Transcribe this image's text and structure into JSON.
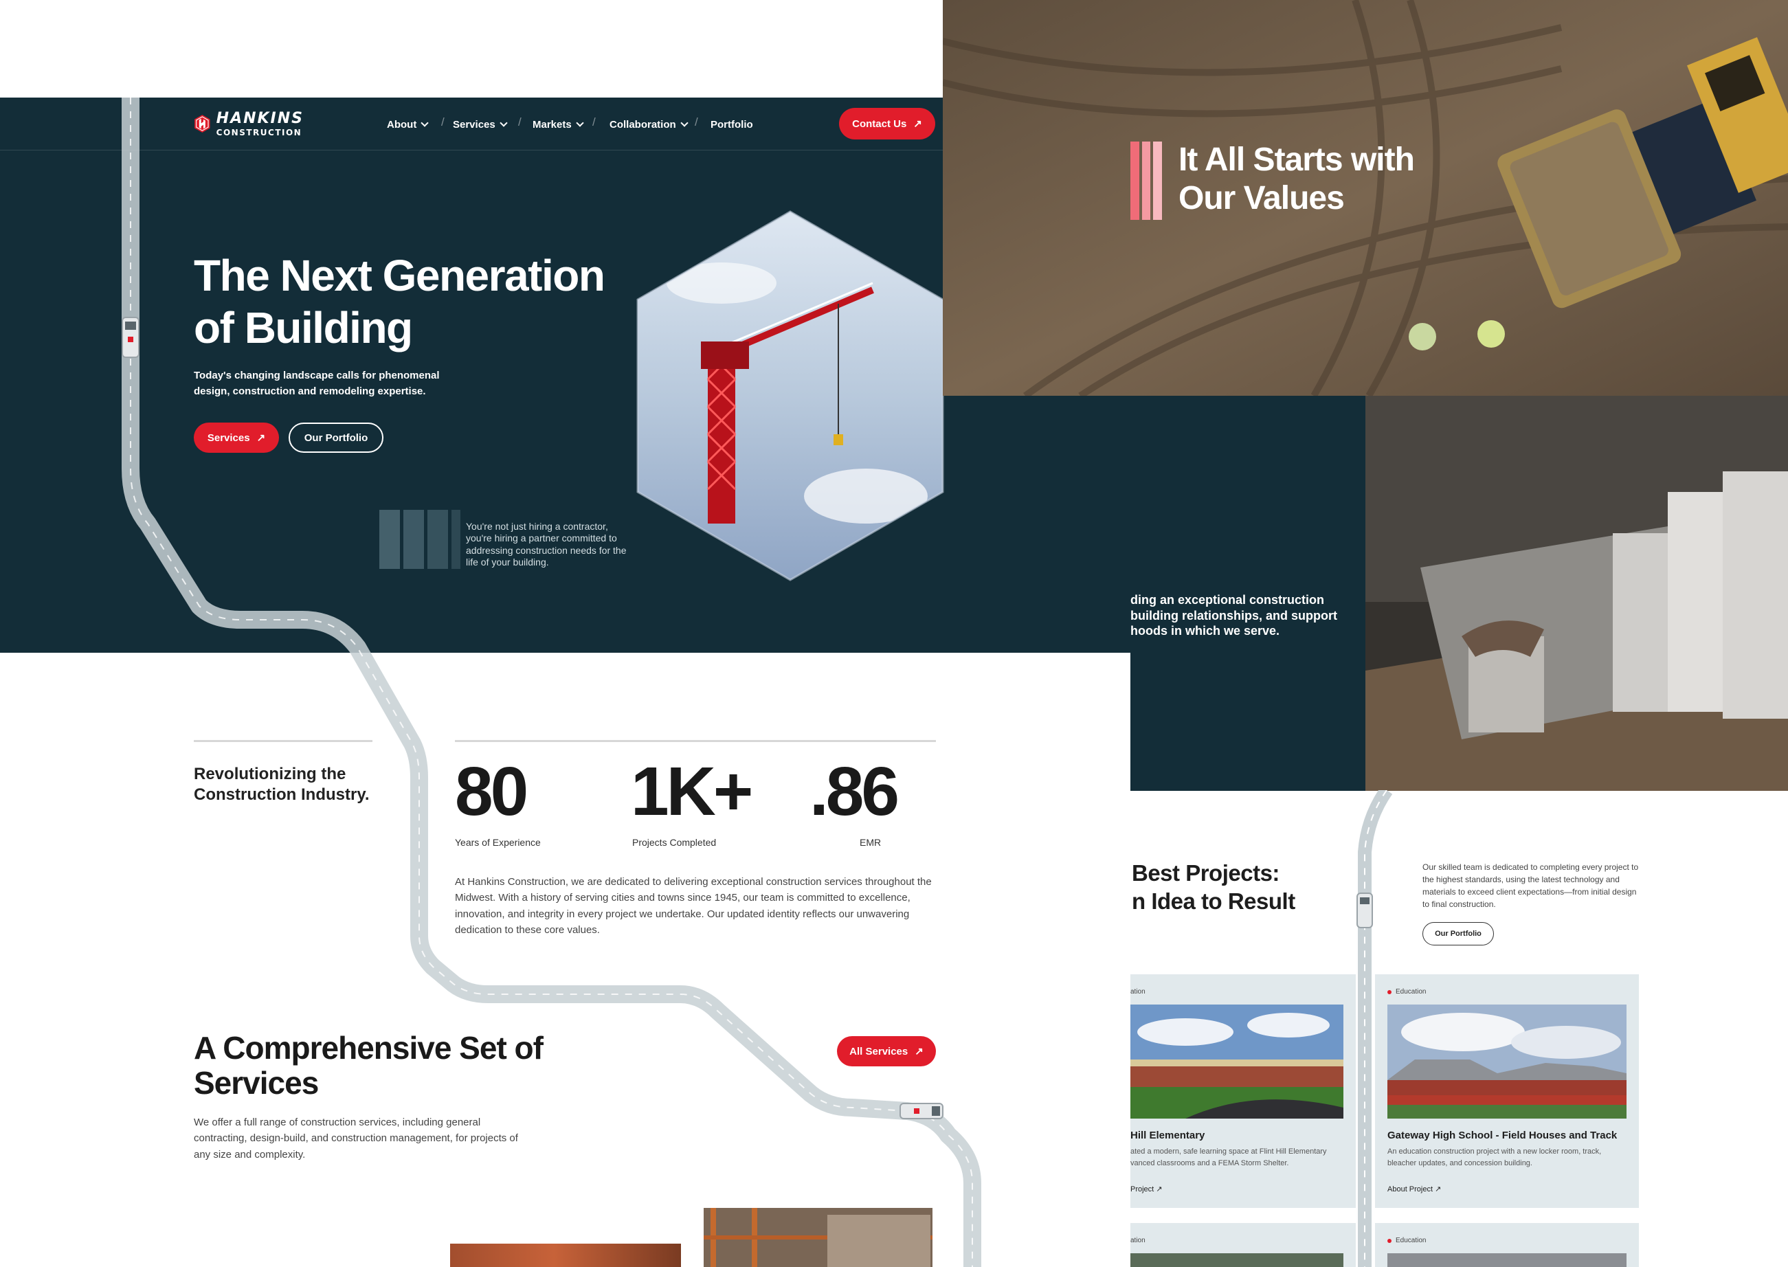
{
  "brand": {
    "name": "HANKINS",
    "subtitle": "CONSTRUCTION",
    "accent_color": "#e11d2b",
    "dark_color": "#132d38"
  },
  "nav": {
    "items": [
      {
        "label": "About",
        "has_dropdown": true
      },
      {
        "label": "Services",
        "has_dropdown": true
      },
      {
        "label": "Markets",
        "has_dropdown": true
      },
      {
        "label": "Collaboration",
        "has_dropdown": true
      },
      {
        "label": "Portfolio",
        "has_dropdown": false
      }
    ],
    "contact_label": "Contact Us"
  },
  "hero": {
    "title": "The Next Generation of Building",
    "subtitle": "Today's changing landscape calls for phenomenal design, construction and remodeling expertise.",
    "primary_button": "Services",
    "secondary_button": "Our Portfolio",
    "quote": "You're not just hiring a contractor, you're hiring a partner committed to addressing construction needs for the life of your building."
  },
  "stats": {
    "heading": "Revolutionizing the Construction Industry.",
    "items": [
      {
        "value": "80",
        "label": "Years of Experience"
      },
      {
        "value": "1K+",
        "label": "Projects Completed"
      },
      {
        "value": ".86",
        "label": "EMR"
      }
    ],
    "about": "At Hankins Construction, we are dedicated to delivering exceptional construction services throughout the Midwest. With a history of serving cities and towns since 1945, our team is committed to excellence, innovation, and integrity in every project we undertake. Our updated identity reflects our unwavering dedication to these core values."
  },
  "services": {
    "title": "A Comprehensive Set of Services",
    "text": "We offer a full range of construction services, including general contracting, design-build, and construction management, for projects of any size and complexity.",
    "button": "All Services"
  },
  "values": {
    "title": "It All Starts with Our Values"
  },
  "mission": {
    "lines": [
      "ding an exceptional construction",
      "building relationships, and support",
      "hoods in which we serve."
    ]
  },
  "projects": {
    "title_lines": [
      "Best Projects:",
      "n Idea to Result"
    ],
    "text": "Our skilled team is dedicated to completing every project to the highest standards, using the latest technology and materials to exceed client expectations—from initial design to final construction.",
    "button": "Our Portfolio",
    "cards": [
      {
        "tag": "ation",
        "title": "Hill Elementary",
        "desc": "ated a modern, safe learning space at Flint Hill Elementary vanced classrooms and a FEMA Storm Shelter.",
        "link": "Project"
      },
      {
        "tag": "Education",
        "title": "Gateway High School - Field Houses and Track",
        "desc": "An education construction project with a new locker room, track, bleacher updates, and concession building.",
        "link": "About Project"
      },
      {
        "tag": "ation",
        "title": "",
        "desc": "",
        "link": ""
      },
      {
        "tag": "Education",
        "title": "",
        "desc": "",
        "link": ""
      }
    ]
  },
  "icons": {
    "arrow": "↗",
    "chevron": "chevron-down-icon",
    "truck": "service-truck-icon"
  }
}
